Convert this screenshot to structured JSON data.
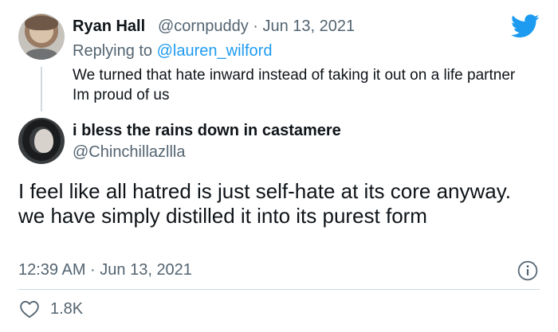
{
  "reply_tweet": {
    "display_name": "Ryan Hall",
    "meta": "@cornpuddy · Jun 13, 2021",
    "replying_prefix": "Replying to ",
    "replying_to": "@lauren_wilford",
    "text": "We turned that hate inward instead of taking it out on a life partner Im proud of us"
  },
  "main_tweet": {
    "display_name": "i bless the rains down in castamere",
    "handle": "@Chinchillazllla",
    "text": "I feel like all hatred is just self-hate at its core anyway. we have simply distilled it into its purest form",
    "timestamp": "12:39 AM · Jun 13, 2021",
    "likes": "1.8K"
  },
  "icons": {
    "brand": "twitter-bird-icon",
    "info": "info-icon",
    "like": "heart-icon"
  },
  "colors": {
    "brand_blue": "#1d9bf0",
    "secondary_text": "#536471",
    "divider": "#cfd9de"
  }
}
